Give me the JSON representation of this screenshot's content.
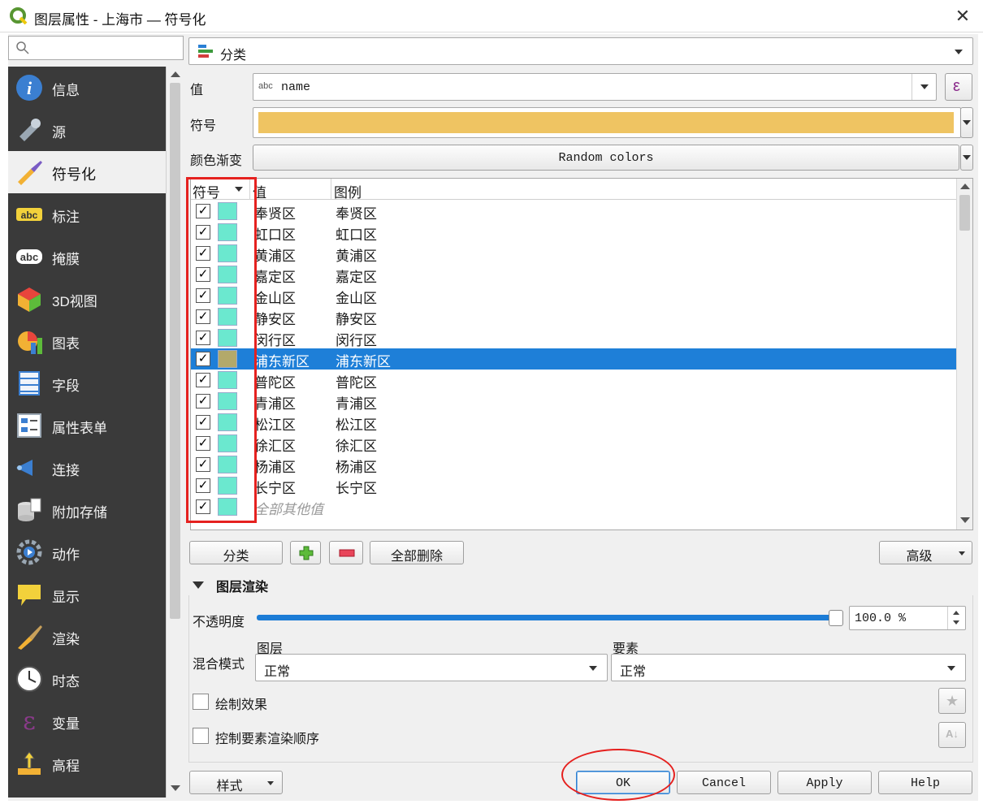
{
  "window": {
    "title": "图层属性 - 上海市 — 符号化",
    "close_glyph": "✕"
  },
  "sidebar": {
    "search_placeholder": "",
    "items": [
      {
        "label": "信息",
        "icon": "info-icon"
      },
      {
        "label": "源",
        "icon": "source-tools-icon"
      },
      {
        "label": "符号化",
        "icon": "symbology-brush-icon",
        "active": true
      },
      {
        "label": "标注",
        "icon": "labels-abc-icon"
      },
      {
        "label": "掩膜",
        "icon": "mask-abc-icon"
      },
      {
        "label": "3D视图",
        "icon": "3d-cube-icon"
      },
      {
        "label": "图表",
        "icon": "diagram-pie-icon"
      },
      {
        "label": "字段",
        "icon": "fields-table-icon"
      },
      {
        "label": "属性表单",
        "icon": "attributes-form-icon"
      },
      {
        "label": "连接",
        "icon": "joins-icon"
      },
      {
        "label": "附加存储",
        "icon": "auxiliary-storage-icon"
      },
      {
        "label": "动作",
        "icon": "actions-gear-icon"
      },
      {
        "label": "显示",
        "icon": "display-bubble-icon"
      },
      {
        "label": "渲染",
        "icon": "rendering-brush-icon"
      },
      {
        "label": "时态",
        "icon": "temporal-clock-icon"
      },
      {
        "label": "变量",
        "icon": "variables-epsilon-icon"
      },
      {
        "label": "高程",
        "icon": "elevation-icon"
      }
    ]
  },
  "renderer": {
    "type_label": "分类",
    "icon": "categorized-renderer-icon"
  },
  "form": {
    "value_label": "值",
    "value_field_type": "abc",
    "value_field": "name",
    "expression_glyph": "ε",
    "symbol_label": "符号",
    "symbol_color": "#efc462",
    "ramp_label": "颜色渐变",
    "ramp_value": "Random colors"
  },
  "table": {
    "headers": {
      "symbol": "符号",
      "value": "值",
      "legend": "图例"
    },
    "rows": [
      {
        "value": "奉贤区",
        "legend": "奉贤区",
        "checked": true,
        "color": "#6be8cf"
      },
      {
        "value": "虹口区",
        "legend": "虹口区",
        "checked": true,
        "color": "#6be8cf"
      },
      {
        "value": "黄浦区",
        "legend": "黄浦区",
        "checked": true,
        "color": "#6be8cf"
      },
      {
        "value": "嘉定区",
        "legend": "嘉定区",
        "checked": true,
        "color": "#6be8cf"
      },
      {
        "value": "金山区",
        "legend": "金山区",
        "checked": true,
        "color": "#6be8cf"
      },
      {
        "value": "静安区",
        "legend": "静安区",
        "checked": true,
        "color": "#6be8cf"
      },
      {
        "value": "闵行区",
        "legend": "闵行区",
        "checked": true,
        "color": "#6be8cf"
      },
      {
        "value": "浦东新区",
        "legend": "浦东新区",
        "checked": true,
        "color": "#b3a96a",
        "selected": true
      },
      {
        "value": "普陀区",
        "legend": "普陀区",
        "checked": true,
        "color": "#6be8cf"
      },
      {
        "value": "青浦区",
        "legend": "青浦区",
        "checked": true,
        "color": "#6be8cf"
      },
      {
        "value": "松江区",
        "legend": "松江区",
        "checked": true,
        "color": "#6be8cf"
      },
      {
        "value": "徐汇区",
        "legend": "徐汇区",
        "checked": true,
        "color": "#6be8cf"
      },
      {
        "value": "杨浦区",
        "legend": "杨浦区",
        "checked": true,
        "color": "#6be8cf"
      },
      {
        "value": "长宁区",
        "legend": "长宁区",
        "checked": true,
        "color": "#6be8cf"
      },
      {
        "value": "全部其他值",
        "legend": "",
        "checked": true,
        "color": "#6be8cf",
        "italic": true
      }
    ],
    "check_glyph": "✓"
  },
  "actions": {
    "classify": "分类",
    "add": "+",
    "remove": "−",
    "delete_all": "全部删除",
    "advanced": "高级"
  },
  "layer_rendering": {
    "section_title": "图层渲染",
    "opacity_label": "不透明度",
    "opacity_value": "100.0 %",
    "opacity_fraction": 1.0,
    "blend_label": "混合模式",
    "layer_label": "图层",
    "layer_blend": "正常",
    "feature_label": "要素",
    "feature_blend": "正常",
    "draw_effects_label": "绘制效果",
    "draw_effects_checked": false,
    "order_label": "控制要素渲染顺序",
    "order_checked": false
  },
  "footer": {
    "style": "样式",
    "ok": "OK",
    "cancel": "Cancel",
    "apply": "Apply",
    "help": "Help"
  },
  "colors": {
    "accent": "#1e7fd8",
    "annotation_red": "#e5211f",
    "nav_bg": "#3a3a3a"
  }
}
